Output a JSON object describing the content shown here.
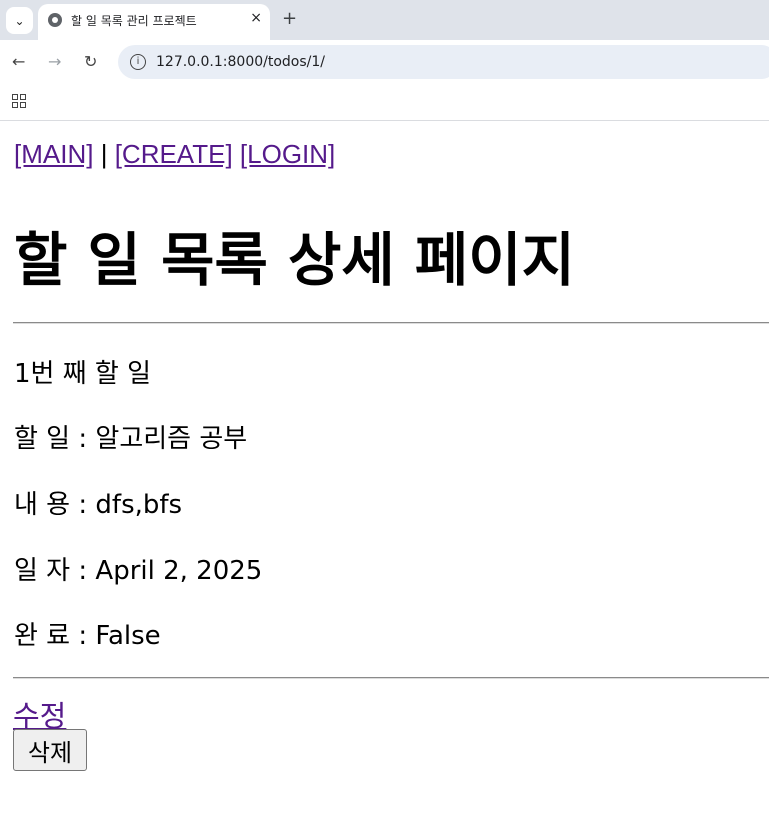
{
  "browser": {
    "tab_title": "할 일 목록 관리 프로젝트",
    "tab_close": "×",
    "new_tab": "+",
    "url": "127.0.0.1:8000/todos/1/"
  },
  "nav": {
    "main": "[MAIN]",
    "separator": "|",
    "create": "[CREATE]",
    "login": "[LOGIN]"
  },
  "page_title": "할 일 목록 상세 페이지",
  "detail": {
    "heading": "1번 째 할 일",
    "title_label": "할 일 :",
    "title_value": "알고리즘 공부",
    "content_label": "내 용 :",
    "content_value": "dfs,bfs",
    "date_label": "일 자 :",
    "date_value": "April 2, 2025",
    "completed_label": "완 료 :",
    "completed_value": "False"
  },
  "actions": {
    "edit": "수정",
    "delete": "삭제"
  },
  "colors": {
    "link_visited": "#551a8b",
    "tabstrip": "#dfe3ea",
    "omnibox": "#e9eef6"
  },
  "icons": [
    "tab-search-icon",
    "globe-icon",
    "close-icon",
    "plus-icon",
    "back-arrow-icon",
    "forward-arrow-icon",
    "reload-icon",
    "site-info-icon",
    "apps-grid-icon"
  ]
}
